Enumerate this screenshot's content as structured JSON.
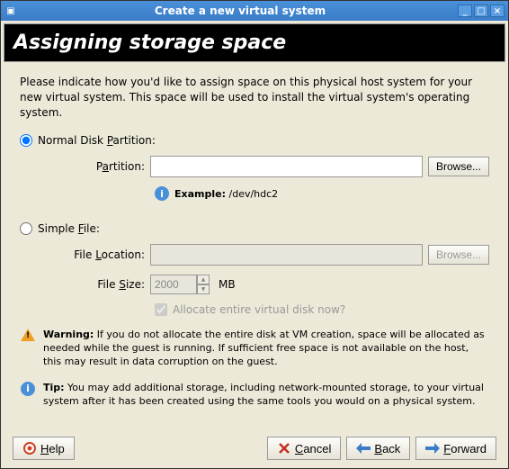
{
  "window": {
    "title": "Create a new virtual system"
  },
  "header": "Assigning storage space",
  "intro": "Please indicate how you'd like to assign space on this physical host system for your new virtual system. This space will be used to install the virtual system's operating system.",
  "option1": {
    "label": "Normal Disk Partition:",
    "selected": true,
    "partition_label": "Partition:",
    "partition_value": "",
    "browse": "Browse...",
    "example_label": "Example:",
    "example_value": "/dev/hdc2"
  },
  "option2": {
    "label": "Simple File:",
    "selected": false,
    "location_label": "File Location:",
    "location_value": "",
    "browse": "Browse...",
    "size_label": "File Size:",
    "size_value": "2000",
    "size_unit": "MB",
    "allocate_label": "Allocate entire virtual disk now?",
    "allocate_checked": true
  },
  "warning": {
    "label": "Warning:",
    "text": "If you do not allocate the entire disk at VM creation, space will be allocated as needed while the guest is running. If sufficient free space is not available on the host, this may result in data corruption on the guest."
  },
  "tip": {
    "label": "Tip:",
    "text": "You may add additional storage, including network-mounted storage, to your virtual system after it has been created using the same tools you would on a physical system."
  },
  "footer": {
    "help": "Help",
    "cancel": "Cancel",
    "back": "Back",
    "forward": "Forward"
  }
}
